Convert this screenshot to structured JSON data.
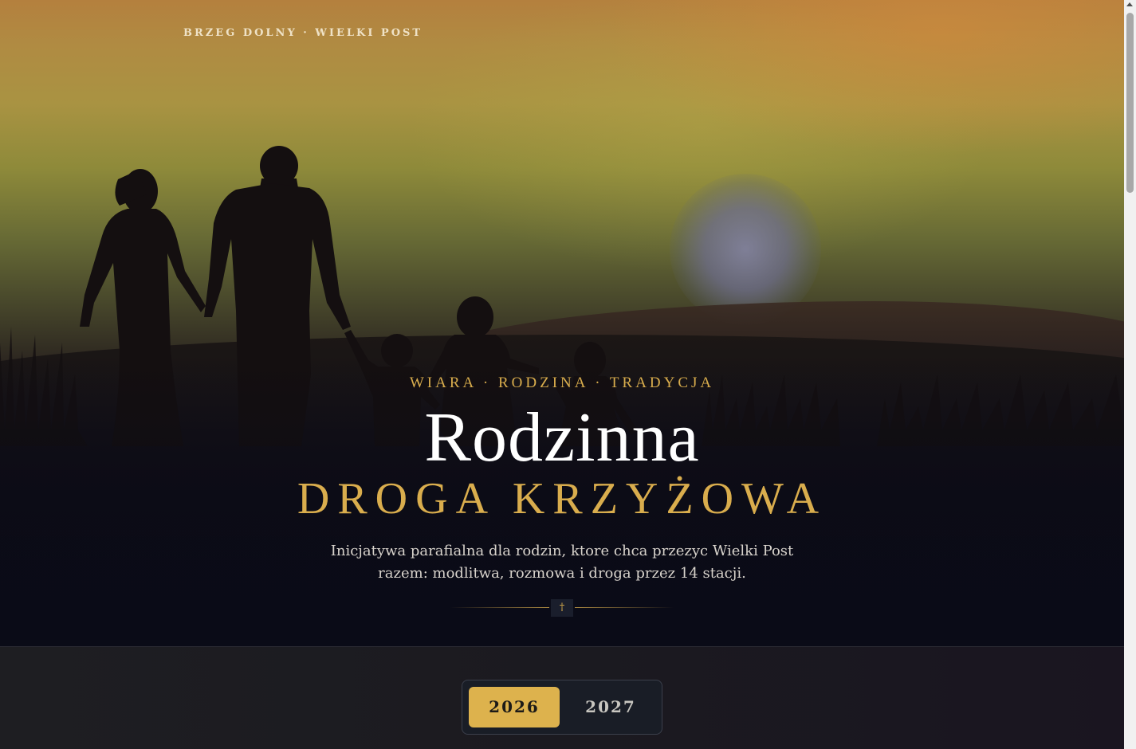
{
  "header": {
    "location_label": "BRZEG DOLNY · WIELKI POST"
  },
  "hero": {
    "tagline": "WIARA · RODZINA · TRADYCJA",
    "title": "Rodzinna",
    "subtitle": "DROGA KRZYŻOWA",
    "lead_line_1": "Inicjatywa parafialna dla rodzin, ktore chca przezyc Wielki Post",
    "lead_line_2": "razem: modlitwa, rozmowa i droga przez 14 stacji.",
    "divider_symbol": "†"
  },
  "year_switch": {
    "options": [
      "2026",
      "2027"
    ],
    "selected": "2026"
  },
  "colors": {
    "accent_gold": "#ddb24d",
    "hero_dark": "#0b0c17",
    "section_bg": "#1e1e22"
  }
}
